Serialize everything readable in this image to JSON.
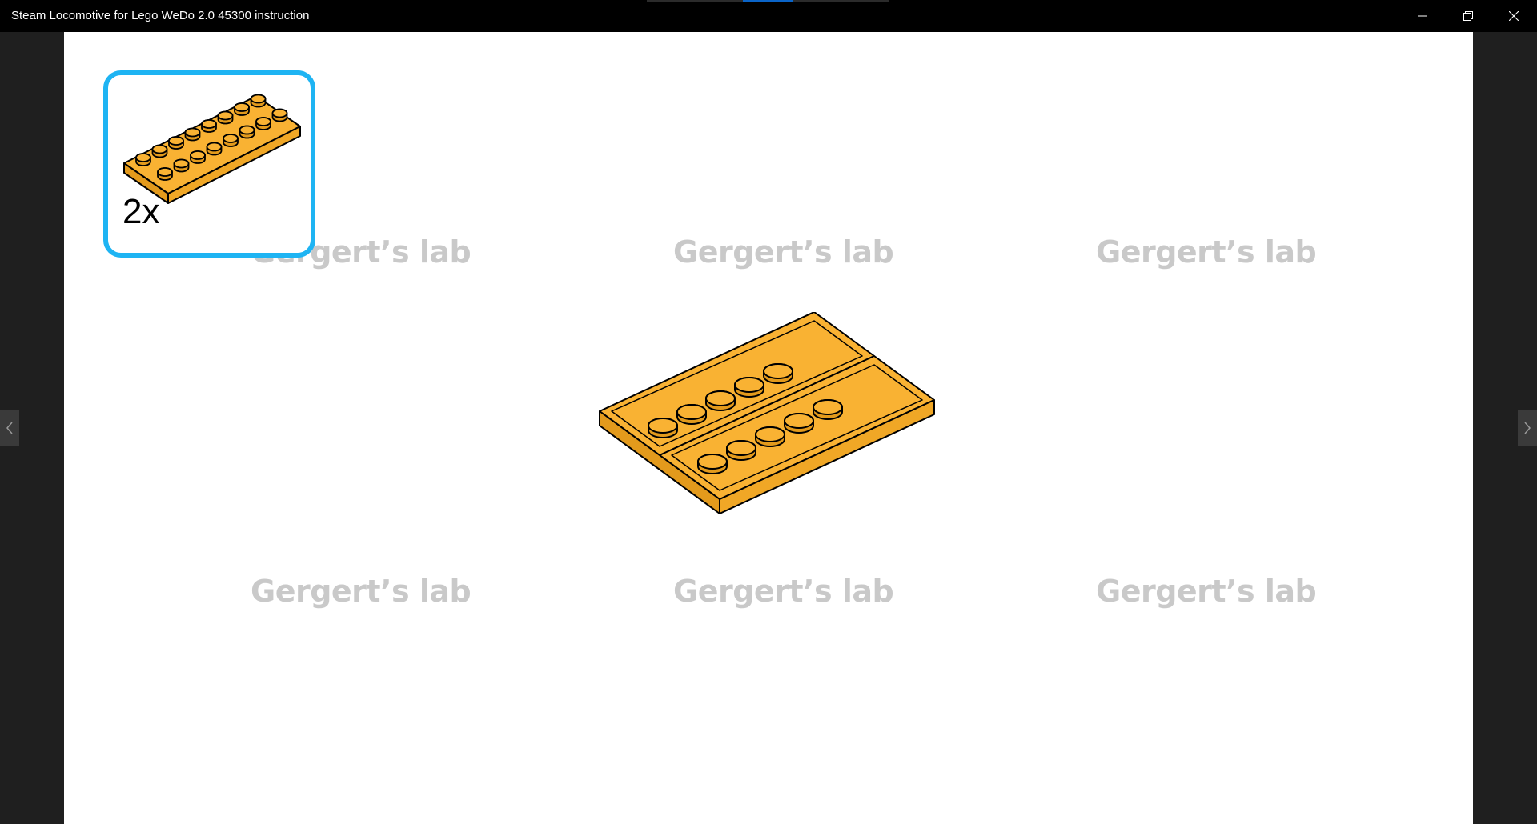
{
  "window": {
    "title": "Steam Locomotive for Lego WeDo 2.0 45300 instruction",
    "controls": [
      "minimize-icon",
      "restore-icon",
      "close-icon"
    ]
  },
  "viewer": {
    "background": "#1f1f1f",
    "prev_icon": "chevron-left-icon",
    "next_icon": "chevron-right-icon"
  },
  "page": {
    "watermark_text": "Gergert’s lab",
    "parts_callout": {
      "count_label": "2x",
      "part_name": "2x8 plate",
      "color": "#f9b233",
      "border_color": "#1eb4f3"
    },
    "model": {
      "description": "two yellow 2x6 tiles/plates side by side",
      "color": "#f9b233"
    }
  }
}
